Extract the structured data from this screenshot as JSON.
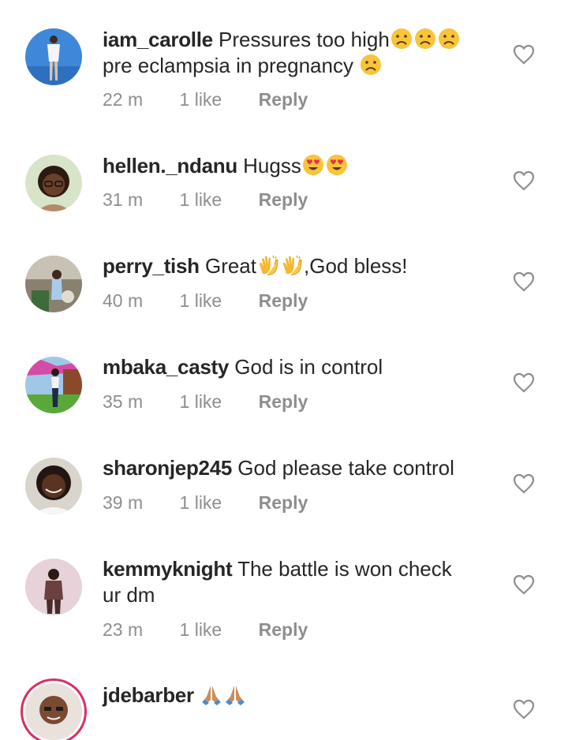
{
  "comments": [
    {
      "username": "iam_carolle",
      "text_line1": "Pressures too high",
      "text_line2": "pre eclampsia in pregnancy",
      "time": "22 m",
      "likes": "1 like",
      "reply": "Reply",
      "emojis_line1": [
        "sad-face-icon",
        "sad-face-icon",
        "sad-face-icon"
      ],
      "emojis_line2": [
        "sad-face-icon"
      ]
    },
    {
      "username": "hellen._ndanu",
      "text": "Hugss",
      "time": "31 m",
      "likes": "1 like",
      "reply": "Reply",
      "emojis": [
        "heart-eyes-face-icon",
        "heart-eyes-face-icon"
      ]
    },
    {
      "username": "perry_tish",
      "text_before": "Great",
      "text_after": ",God bless!",
      "time": "40 m",
      "likes": "1 like",
      "reply": "Reply",
      "emojis": [
        "clapping-hands-icon",
        "clapping-hands-icon"
      ]
    },
    {
      "username": "mbaka_casty",
      "text": "God is in control",
      "time": "35 m",
      "likes": "1 like",
      "reply": "Reply"
    },
    {
      "username": "sharonjep245",
      "text": "God please take control",
      "time": "39 m",
      "likes": "1 like",
      "reply": "Reply"
    },
    {
      "username": "kemmyknight",
      "text_line1": "The battle is won check",
      "text_line2": "ur dm",
      "time": "23 m",
      "likes": "1 like",
      "reply": "Reply"
    },
    {
      "username": "jdebarber",
      "text": "",
      "emojis": [
        "folded-hands-icon",
        "folded-hands-icon"
      ]
    }
  ],
  "colors": {
    "text": "#262626",
    "meta": "#8e8e8e",
    "story_ring": "#d92e62"
  }
}
